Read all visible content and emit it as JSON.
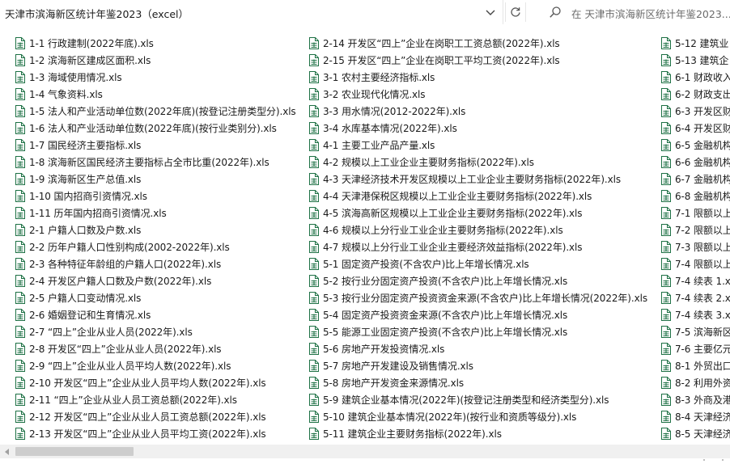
{
  "address_bar": {
    "path": "天津市滨海新区统计年鉴2023（excel）"
  },
  "search": {
    "placeholder": "在 天津市滨海新区统计年鉴2023..."
  },
  "colors": {
    "icon_green": "#1e7145",
    "scroll_thumb": "#cdcdcd"
  },
  "columns": [
    {
      "files": [
        "1-1 行政建制(2022年底).xls",
        "1-2 滨海新区建成区面积.xls",
        "1-3 海域使用情况.xls",
        "1-4 气象资料.xls",
        "1-5 法人和产业活动单位数(2022年底)(按登记注册类型分).xls",
        "1-6 法人和产业活动单位数(2022年底)(按行业类别分).xls",
        "1-7 国民经济主要指标.xls",
        "1-8 滨海新区国民经济主要指标占全市比重(2022年).xls",
        "1-9 滨海新区生产总值.xls",
        "1-10 国内招商引资情况.xls",
        "1-11 历年国内招商引资情况.xls",
        "2-1 户籍人口数及户数.xls",
        "2-2 历年户籍人口性别构成(2002-2022年).xls",
        "2-3 各种特征年龄组的户籍人口(2022年).xls",
        "2-4 开发区户籍人口数及户数(2022年).xls",
        "2-5 户籍人口变动情况.xls",
        "2-6 婚姻登记和生育情况.xls",
        "2-7 “四上”企业从业人员(2022年).xls",
        "2-8 开发区“四上”企业从业人员(2022年).xls",
        "2-9 “四上”企业从业人员平均人数(2022年).xls",
        "2-10 开发区“四上”企业从业人员平均人数(2022年).xls",
        "2-11 “四上”企业从业人员工资总额(2022年).xls",
        "2-12 开发区“四上”企业从业人员工资总额(2022年).xls",
        "2-13 开发区“四上”企业从业人员平均工资(2022年).xls"
      ]
    },
    {
      "files": [
        "2-14 开发区“四上”企业在岗职工工资总额(2022年).xls",
        "2-15 开发区“四上”企业在岗职工平均工资(2022年).xls",
        "3-1 农村主要经济指标.xls",
        "3-2 农业现代化情况.xls",
        "3-3 用水情况(2012-2022年).xls",
        "3-4 水库基本情况(2022年).xls",
        "4-1 主要工业产品产量.xls",
        "4-2 规模以上工业企业主要财务指标(2022年).xls",
        "4-3 天津经济技术开发区规模以上工业企业主要财务指标(2022年).xls",
        "4-4 天津港保税区规模以上工业企业主要财务指标(2022年).xls",
        "4-5 滨海高新区规模以上工业企业主要财务指标(2022年).xls",
        "4-6 规模以上分行业工业企业主要财务指标(2022年).xls",
        "4-7 规模以上分行业工业企业主要经济效益指标(2022年).xls",
        "5-1 固定资产投资(不含农户)比上年增长情况.xls",
        "5-2 按行业分固定资产投资(不含农户)比上年增长情况.xls",
        "5-3 按行业分固定资产投资资金来源(不含农户)比上年增长情况(2022年).xls",
        "5-4 固定资产投资资金来源(不含农户)比上年增长情况.xls",
        "5-5 能源工业固定资产投资(不含农户)比上年增长情况.xls",
        "5-6 房地产开发投资情况.xls",
        "5-7 房地产开发建设及销售情况.xls",
        "5-8 房地产开发资金来源情况.xls",
        "5-9 建筑企业基本情况(2022年)(按登记注册类型和经济类型分).xls",
        "5-10 建筑企业基本情况(2022年)(按行业和资质等级分).xls",
        "5-11 建筑企业主要财务指标(2022年).xls"
      ]
    },
    {
      "files": [
        "5-12 建筑业",
        "5-13 建筑企",
        "6-1 财政收入",
        "6-2 财政支出",
        "6-3 开发区财",
        "6-4 开发区财",
        "6-5 金融机构",
        "6-6 金融机构",
        "6-7 金融机构",
        "6-8 金融机构",
        "7-1 限额以上",
        "7-2 限额以上",
        "7-3 限额以上",
        "7-4 限额以上",
        "7-4 续表 1.x",
        "7-4 续表 2.x",
        "7-4 续表 3.x",
        "7-5 滨海新区",
        "7-6 主要亿元",
        "8-1 外贸出口",
        "8-2 利用外资",
        "8-3 外商及港",
        "8-4 天津经济",
        "8-5 天津经济"
      ]
    }
  ]
}
